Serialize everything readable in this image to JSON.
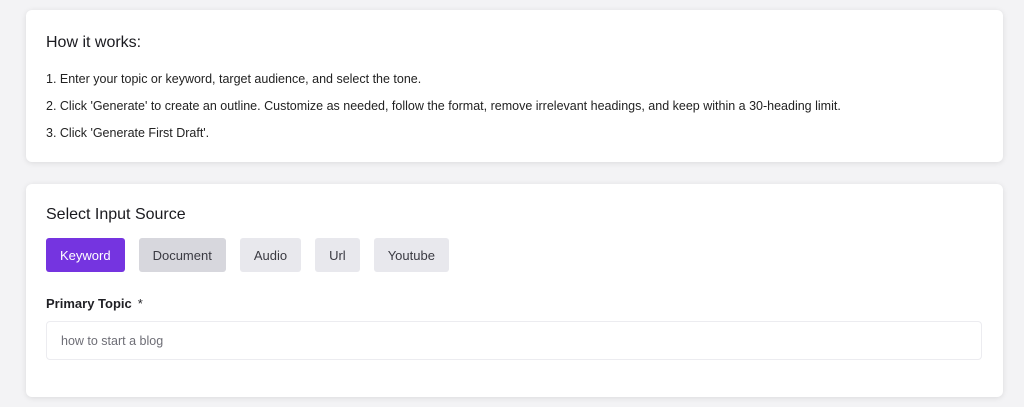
{
  "how_it_works": {
    "title": "How it works:",
    "steps": [
      "1. Enter your topic or keyword, target audience, and select the tone.",
      "2. Click 'Generate' to create an outline. Customize as needed, follow the format, remove irrelevant headings, and keep within a 30-heading limit.",
      "3. Click 'Generate First Draft'."
    ]
  },
  "input_source": {
    "title": "Select Input Source",
    "options": [
      "Keyword",
      "Document",
      "Audio",
      "Url",
      "Youtube"
    ],
    "selected": "Keyword"
  },
  "primary_topic": {
    "label": "Primary Topic",
    "required_mark": "*",
    "placeholder": "how to start a blog"
  },
  "colors": {
    "accent": "#7534e0",
    "page_background": "#f3f3f5",
    "button_background": "#e8e8ed"
  }
}
